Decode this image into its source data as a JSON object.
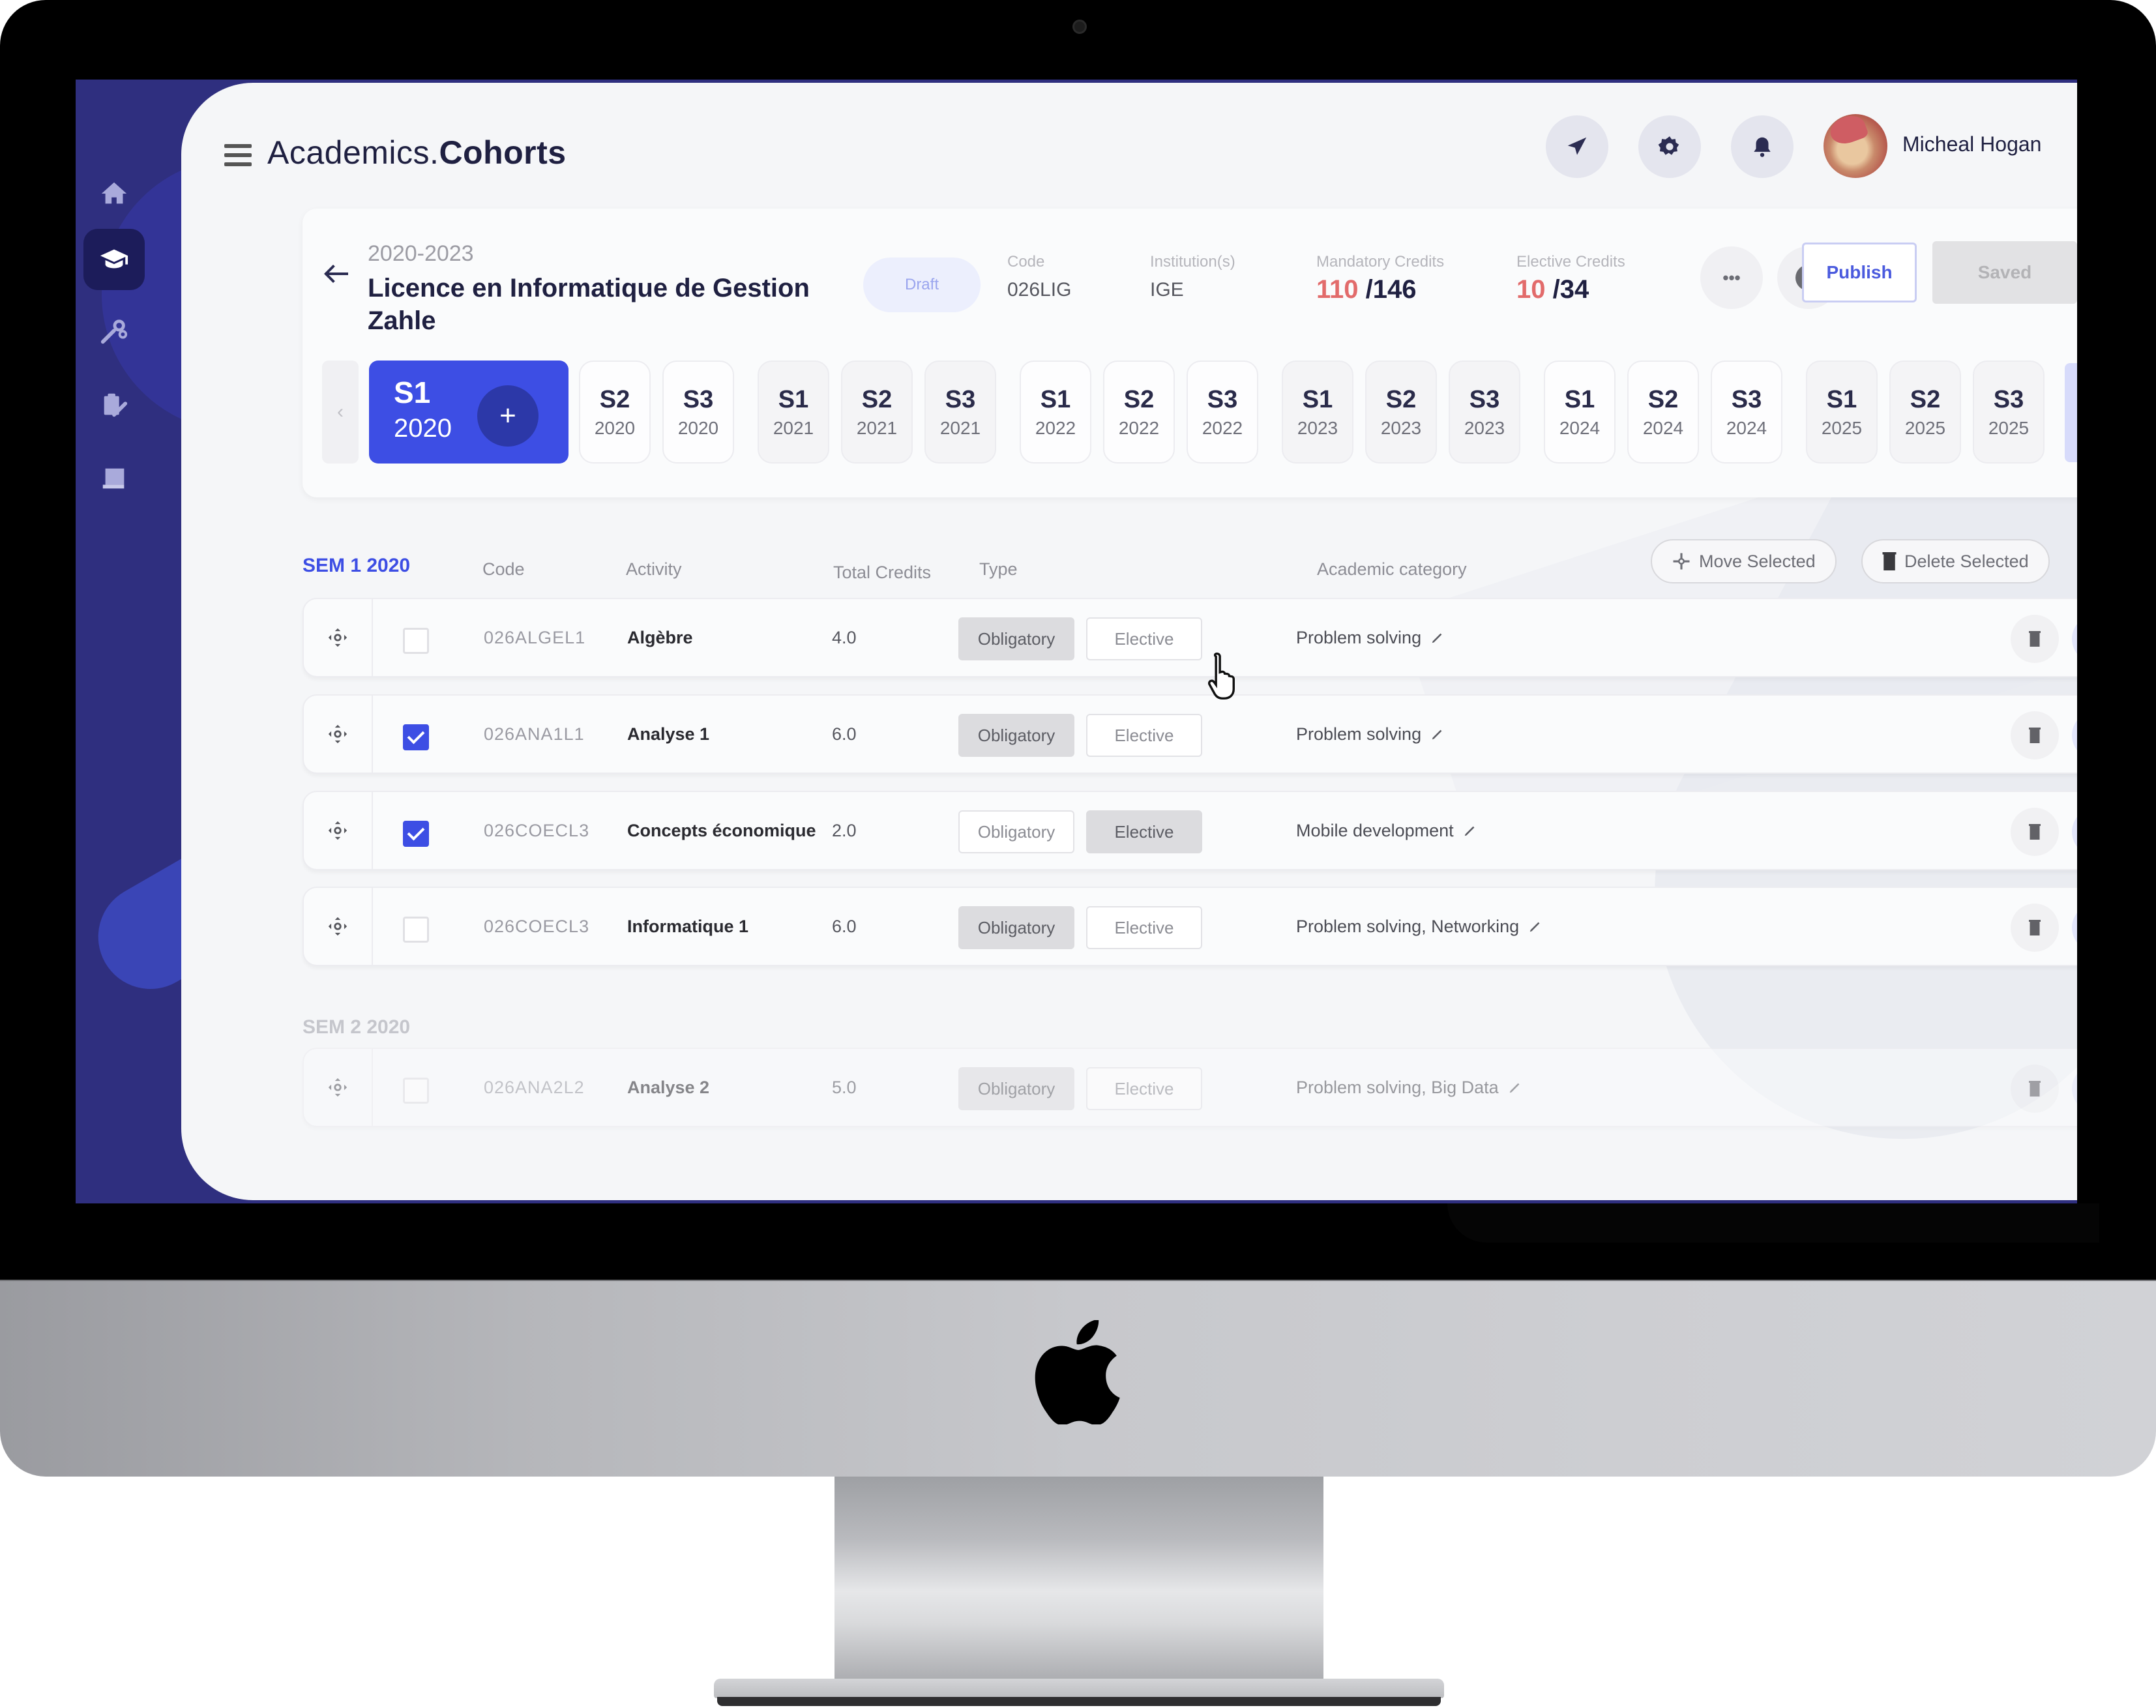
{
  "app": {
    "title_prefix": "Academics.",
    "title_bold": "Cohorts",
    "user_name": "Micheal Hogan"
  },
  "sidebar": {
    "items": [
      {
        "name": "home",
        "active": false
      },
      {
        "name": "cohorts",
        "active": true
      },
      {
        "name": "tools",
        "active": false
      },
      {
        "name": "assignments",
        "active": false
      },
      {
        "name": "library",
        "active": false
      }
    ]
  },
  "topbar": {
    "icons": [
      "send-icon",
      "settings-icon",
      "bell-icon"
    ]
  },
  "program": {
    "period": "2020-2023",
    "title": "Licence en Informatique de Gestion Zahle",
    "status": "Draft",
    "code_label": "Code",
    "code_value": "026LIG",
    "institution_label": "Institution(s)",
    "institution_value": "IGE",
    "mandatory_label": "Mandatory Credits",
    "mandatory_current": "110",
    "mandatory_total": "/146",
    "elective_label": "Elective Credits",
    "elective_current": "10",
    "elective_total": "/34",
    "more_label": "•••",
    "publish_label": "Publish",
    "saved_label": "Saved"
  },
  "semesters": {
    "prev_label": "‹",
    "next_label": "›",
    "active": {
      "sem": "S1",
      "year": "2020",
      "add_label": "+"
    },
    "chips": [
      {
        "sem": "S2",
        "year": "2020",
        "tint": false
      },
      {
        "sem": "S3",
        "year": "2020",
        "tint": false
      },
      {
        "sem": "S1",
        "year": "2021",
        "tint": true
      },
      {
        "sem": "S2",
        "year": "2021",
        "tint": true
      },
      {
        "sem": "S3",
        "year": "2021",
        "tint": true
      },
      {
        "sem": "S1",
        "year": "2022",
        "tint": false
      },
      {
        "sem": "S2",
        "year": "2022",
        "tint": false
      },
      {
        "sem": "S3",
        "year": "2022",
        "tint": false
      },
      {
        "sem": "S1",
        "year": "2023",
        "tint": true
      },
      {
        "sem": "S2",
        "year": "2023",
        "tint": true
      },
      {
        "sem": "S3",
        "year": "2023",
        "tint": true
      },
      {
        "sem": "S1",
        "year": "2024",
        "tint": false
      },
      {
        "sem": "S2",
        "year": "2024",
        "tint": false
      },
      {
        "sem": "S3",
        "year": "2024",
        "tint": false
      },
      {
        "sem": "S1",
        "year": "2025",
        "tint": true
      },
      {
        "sem": "S2",
        "year": "2025",
        "tint": true
      },
      {
        "sem": "S3",
        "year": "2025",
        "tint": true
      }
    ]
  },
  "table": {
    "headers": {
      "code": "Code",
      "activity": "Activity",
      "credits": "Total Credits",
      "type": "Type",
      "category": "Academic category"
    },
    "move_selected_label": "Move Selected",
    "delete_selected_label": "Delete Selected",
    "type_options": [
      "Obligatory",
      "Elective"
    ],
    "groups": [
      {
        "label": "SEM 1 2020",
        "active": true,
        "rows": [
          {
            "checked": false,
            "code": "026ALGEL1",
            "activity": "Algèbre",
            "credits": "4.0",
            "type": "Obligatory",
            "category": "Problem solving"
          },
          {
            "checked": true,
            "code": "026ANA1L1",
            "activity": "Analyse 1",
            "credits": "6.0",
            "type": "Obligatory",
            "category": "Problem solving"
          },
          {
            "checked": true,
            "code": "026COECL3",
            "activity": "Concepts économique",
            "credits": "2.0",
            "type": "Elective",
            "category": "Mobile development"
          },
          {
            "checked": false,
            "code": "026COECL3",
            "activity": "Informatique 1",
            "credits": "6.0",
            "type": "Obligatory",
            "category": "Problem solving, Networking"
          }
        ]
      },
      {
        "label": "SEM 2 2020",
        "active": false,
        "rows": [
          {
            "checked": false,
            "code": "026ANA2L2",
            "activity": "Analyse 2",
            "credits": "5.0",
            "type": "Obligatory",
            "category": "Problem solving, Big Data"
          }
        ]
      }
    ]
  },
  "colors": {
    "accent": "#3d4ee4",
    "sidebar": "#2f2f7f",
    "credit_current": "#e26b6b",
    "text_dark": "#1f2041"
  }
}
